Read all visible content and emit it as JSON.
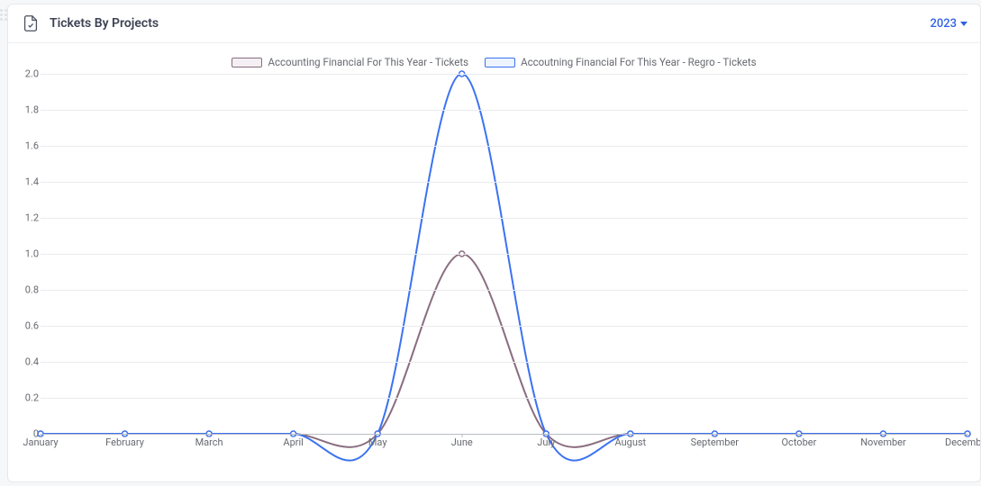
{
  "header": {
    "title": "Tickets By Projects",
    "year": "2023"
  },
  "legend": {
    "series1_label": "Accounting Financial For This Year - Tickets",
    "series2_label": "Accoutning Financial For This Year - Regro - Tickets"
  },
  "y_ticks": [
    "0",
    "0.2",
    "0.4",
    "0.6",
    "0.8",
    "1.0",
    "1.2",
    "1.4",
    "1.6",
    "1.8",
    "2.0"
  ],
  "x_ticks": [
    "January",
    "February",
    "March",
    "April",
    "May",
    "June",
    "July",
    "August",
    "September",
    "October",
    "November",
    "December"
  ],
  "chart_data": {
    "type": "line",
    "categories": [
      "January",
      "February",
      "March",
      "April",
      "May",
      "June",
      "July",
      "August",
      "September",
      "October",
      "November",
      "December"
    ],
    "series": [
      {
        "name": "Accounting Financial For This Year - Tickets",
        "color": "#8a6d80",
        "values": [
          0,
          0,
          0,
          0,
          0,
          1,
          0,
          0,
          0,
          0,
          0,
          0
        ]
      },
      {
        "name": "Accoutning Financial For This Year - Regro - Tickets",
        "color": "#3b72f2",
        "values": [
          0,
          0,
          0,
          0,
          0,
          2,
          0,
          0,
          0,
          0,
          0,
          0
        ]
      }
    ],
    "ylim": [
      0,
      2
    ],
    "xlabel": "",
    "ylabel": "",
    "title": "Tickets By Projects"
  }
}
